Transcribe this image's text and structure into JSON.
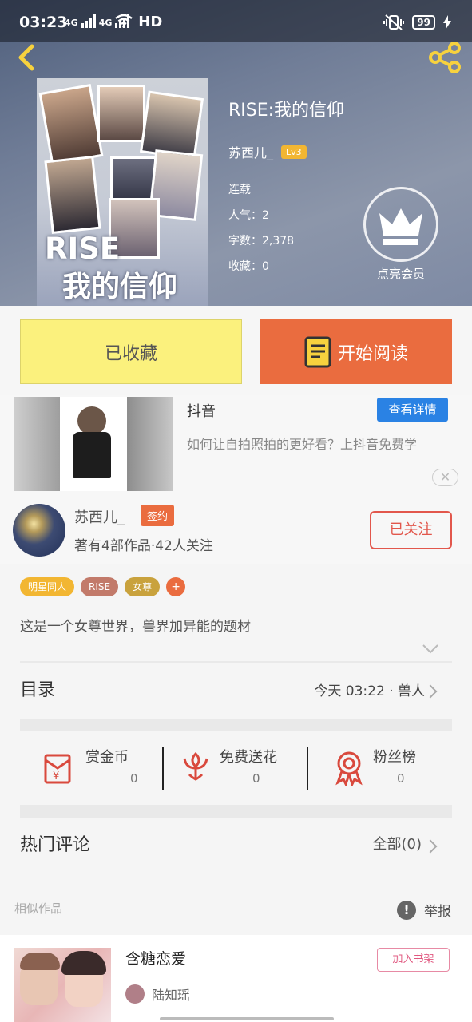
{
  "status_bar": {
    "time": "03:23",
    "net_1": "4G",
    "net_2": "4G",
    "hd": "HD",
    "battery": "99"
  },
  "header": {
    "back_icon": "chevron-left-icon",
    "share_icon": "share-icon"
  },
  "book": {
    "cover_title": "RISE",
    "cover_subtitle": "我的信仰",
    "title": "RISE:我的信仰",
    "author": "苏西儿_",
    "level": "Lv3",
    "status": "连载",
    "popularity": "人气：2",
    "word_count": "字数：2,378",
    "favorites": "收藏：0",
    "vip_label": "点亮会员"
  },
  "actions": {
    "favorited_label": "已收藏",
    "read_label": "开始阅读"
  },
  "ad": {
    "title": "抖音",
    "detail_button": "查看详情",
    "description": "如何让自拍照拍的更好看？上抖音免费学",
    "close": "✕"
  },
  "author_card": {
    "name": "苏西儿_",
    "badge": "签约",
    "stats": "著有4部作品·42人关注",
    "follow_label": "已关注"
  },
  "tags": [
    "明星同人",
    "RISE",
    "女尊",
    "+"
  ],
  "tag_colors": [
    "#f2b632",
    "#c27a6a",
    "#c9a23d"
  ],
  "description": "这是一个女尊世界，兽界加异能的题材",
  "catalog": {
    "title": "目录",
    "latest": "今天 03:22 · 兽人"
  },
  "stats": [
    {
      "label": "赏金币",
      "value": "0"
    },
    {
      "label": "免费送花",
      "value": "0"
    },
    {
      "label": "粉丝榜",
      "value": "0"
    }
  ],
  "comments": {
    "title": "热门评论",
    "all": "全部(0)"
  },
  "similar": {
    "title": "相似作品",
    "report": "举报"
  },
  "recommendation": {
    "title": "含糖恋爱",
    "author": "陆知瑶",
    "add_button": "加入书架"
  },
  "colors": {
    "accent_orange": "#ea6c3f",
    "favorite_yellow": "#fbf17d",
    "link_blue": "#2a82e4",
    "follow_red": "#e2574c"
  }
}
